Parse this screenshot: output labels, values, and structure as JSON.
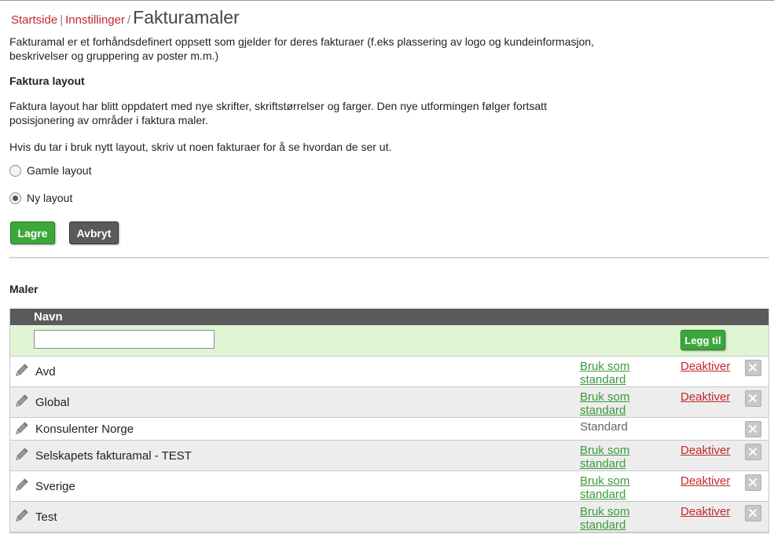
{
  "breadcrumb": {
    "home": "Startside",
    "sep1": "|",
    "settings": "Innstillinger",
    "sep2": "/",
    "current": "Fakturamaler"
  },
  "intro": {
    "line1": "Fakturamal er et forhåndsdefinert oppsett som gjelder for deres fakturaer (f.eks plassering av logo og kundeinformasjon,",
    "line2": "beskrivelser og gruppering av poster m.m.)"
  },
  "layout": {
    "heading": "Faktura layout",
    "desc_line1": "Faktura layout har blitt oppdatert med nye skrifter, skriftstørrelser og farger. Den nye utformingen følger fortsatt",
    "desc_line2": "posisjonering av områder i faktura maler.",
    "hint": "Hvis du tar i bruk nytt layout, skriv ut noen fakturaer for å se hvordan de ser ut.",
    "options": [
      {
        "label": "Gamle layout",
        "checked": false
      },
      {
        "label": "Ny layout",
        "checked": true
      }
    ],
    "save_label": "Lagre",
    "cancel_label": "Avbryt"
  },
  "templates": {
    "heading": "Maler",
    "column_name": "Navn",
    "new_name_value": "",
    "add_label": "Legg til",
    "rows": [
      {
        "name": "Avd",
        "std1": "Bruk som",
        "std2": "standard",
        "deactivate": "Deaktiver"
      },
      {
        "name": "Global",
        "std1": "Bruk som",
        "std2": "standard",
        "deactivate": "Deaktiver"
      },
      {
        "name": "Konsulenter Norge",
        "std1": "Standard",
        "std2": "",
        "deactivate": ""
      },
      {
        "name": "Selskapets fakturamal - TEST",
        "std1": "Bruk som",
        "std2": "standard",
        "deactivate": "Deaktiver"
      },
      {
        "name": "Sverige",
        "std1": "Bruk som",
        "std2": "standard",
        "deactivate": "Deaktiver"
      },
      {
        "name": "Test",
        "std1": "Bruk som",
        "std2": "standard",
        "deactivate": "Deaktiver"
      }
    ]
  },
  "colors": {
    "link_red": "#c0282d",
    "accent_green": "#3ca73a",
    "header_gray": "#5a5a5a",
    "add_row_bg": "#dff5d4"
  }
}
